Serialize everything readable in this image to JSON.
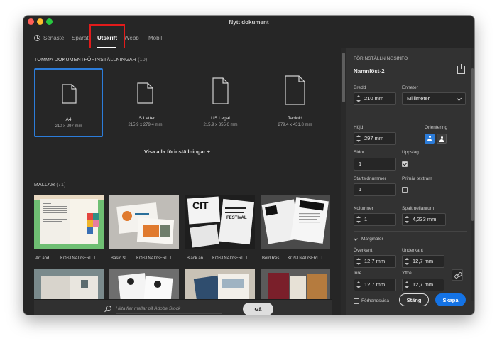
{
  "window": {
    "title": "Nytt dokument"
  },
  "tabs": [
    {
      "label": "Senaste"
    },
    {
      "label": "Sparat"
    },
    {
      "label": "Utskrift"
    },
    {
      "label": "Webb"
    },
    {
      "label": "Mobil"
    }
  ],
  "presets": {
    "title": "TOMMA DOKUMENTFÖRINSTÄLLNINGAR",
    "count": "(10)",
    "items": [
      {
        "name": "A4",
        "size": "210 x 297 mm"
      },
      {
        "name": "US Letter",
        "size": "215,9 x 279,4 mm"
      },
      {
        "name": "US Legal",
        "size": "215,9 x 355,6 mm"
      },
      {
        "name": "Tabloid",
        "size": "279,4 x 431,8 mm"
      }
    ],
    "show_all": "Visa alla förinställningar +"
  },
  "templates": {
    "title": "MALLAR",
    "count": "(71)",
    "items": [
      {
        "name": "Art and...",
        "badge": "KOSTNADSFRITT"
      },
      {
        "name": "Basic St...",
        "badge": "KOSTNADSFRITT"
      },
      {
        "name": "Black an...",
        "badge": "KOSTNADSFRITT"
      },
      {
        "name": "Bold Res...",
        "badge": "KOSTNADSFRITT"
      }
    ],
    "thumb_text_cit": "CIT",
    "thumb_text_festival": "FESTIVAL"
  },
  "search": {
    "placeholder": "Hitta fler mallar på Adobe Stock",
    "go_label": "Gå"
  },
  "settings": {
    "header": "FÖRINSTÄLLNINGSINFO",
    "doc_name": "Namnlöst-2",
    "width_label": "Bredd",
    "width_value": "210 mm",
    "units_label": "Enheter",
    "units_value": "Millimeter",
    "height_label": "Höjd",
    "height_value": "297 mm",
    "orientation_label": "Orientering",
    "pages_label": "Sidor",
    "pages_value": "1",
    "spread_label": "Uppslag",
    "start_label": "Startsidnummer",
    "start_value": "1",
    "primary_frame_label": "Primär textram",
    "columns_label": "Kolumner",
    "columns_value": "1",
    "gutter_label": "Spaltmellanrum",
    "gutter_value": "4,233 mm",
    "margins_label": "Marginaler",
    "top_label": "Överkant",
    "top_value": "12,7 mm",
    "bottom_label": "Underkant",
    "bottom_value": "12,7 mm",
    "inside_label": "Inre",
    "inside_value": "12,7 mm",
    "outside_label": "Yttre",
    "outside_value": "12,7 mm",
    "preview_label": "Förhandsvisa",
    "close_label": "Stäng",
    "create_label": "Skapa"
  },
  "colors": {
    "accent": "#2c7cd9",
    "create_button": "#1473e6",
    "highlight": "#e21b1b"
  }
}
